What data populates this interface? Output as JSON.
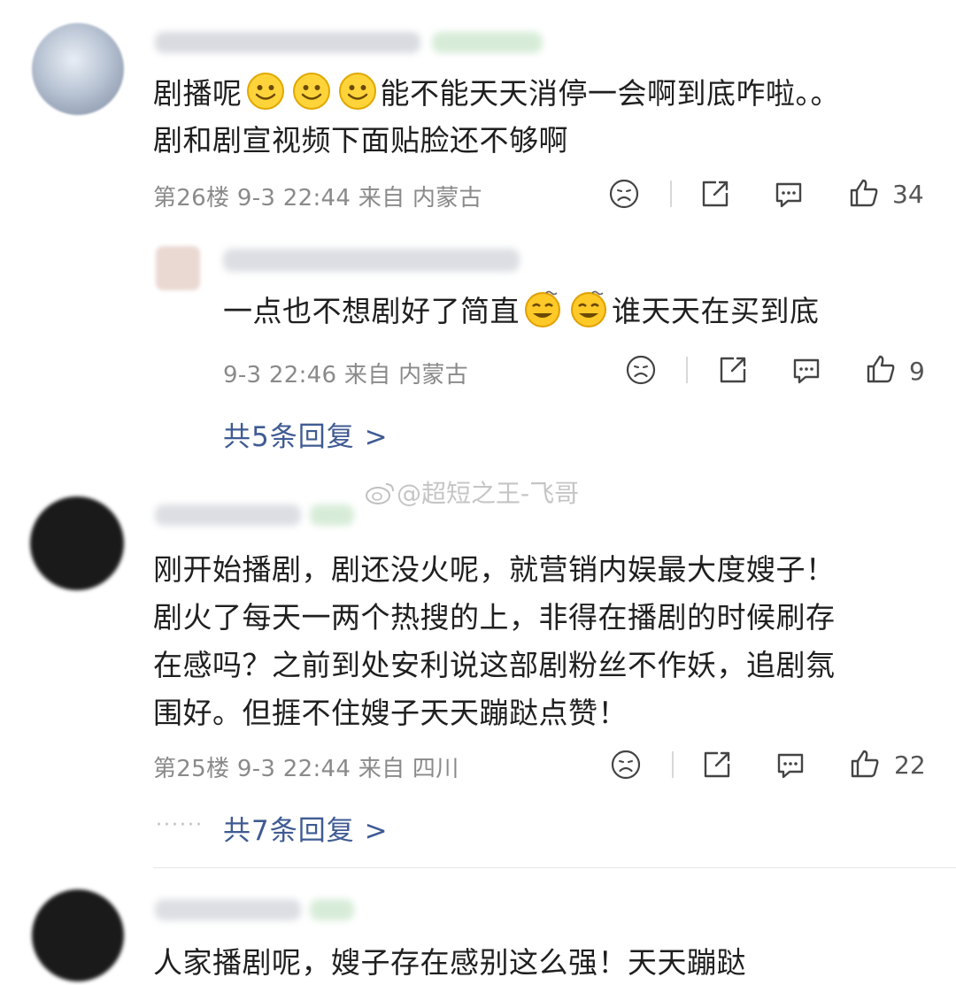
{
  "comments": [
    {
      "text_line1_a": "剧播呢",
      "text_line1_b": "能不能天天消停一会啊到底咋啦。。",
      "text_line2": "剧和剧宣视频下面贴脸还不够啊",
      "emoji": "smile-emoji",
      "meta": "第26楼 9-3 22:44 来自 内蒙古",
      "likes": "34",
      "reply": {
        "text_a": "一点也不想剧好了简直",
        "text_b": "谁天天在买到底",
        "emoji": "dizzy-smile-emoji",
        "meta": "9-3 22:46 来自 内蒙古",
        "likes": "9"
      },
      "more_replies": "共5条回复 >"
    },
    {
      "lines": [
        "刚开始播剧，剧还没火呢，就营销内娱最大度嫂子！",
        "剧火了每天一两个热搜的上，非得在播剧的时候刷存",
        "在感吗？之前到处安利说这部剧粉丝不作妖，追剧氛",
        "围好。但捱不住嫂子天天蹦跶点赞！"
      ],
      "meta": "第25楼 9-3 22:44 来自 四川",
      "likes": "22",
      "more_replies": "共7条回复 >"
    },
    {
      "text": "人家播剧呢，嫂子存在感别这么强！天天蹦跶"
    }
  ],
  "watermark": "@超短之王-飞哥",
  "colors": {
    "link": "#3f5b93",
    "meta": "#8a8a8a",
    "text": "#1f1f1f"
  }
}
